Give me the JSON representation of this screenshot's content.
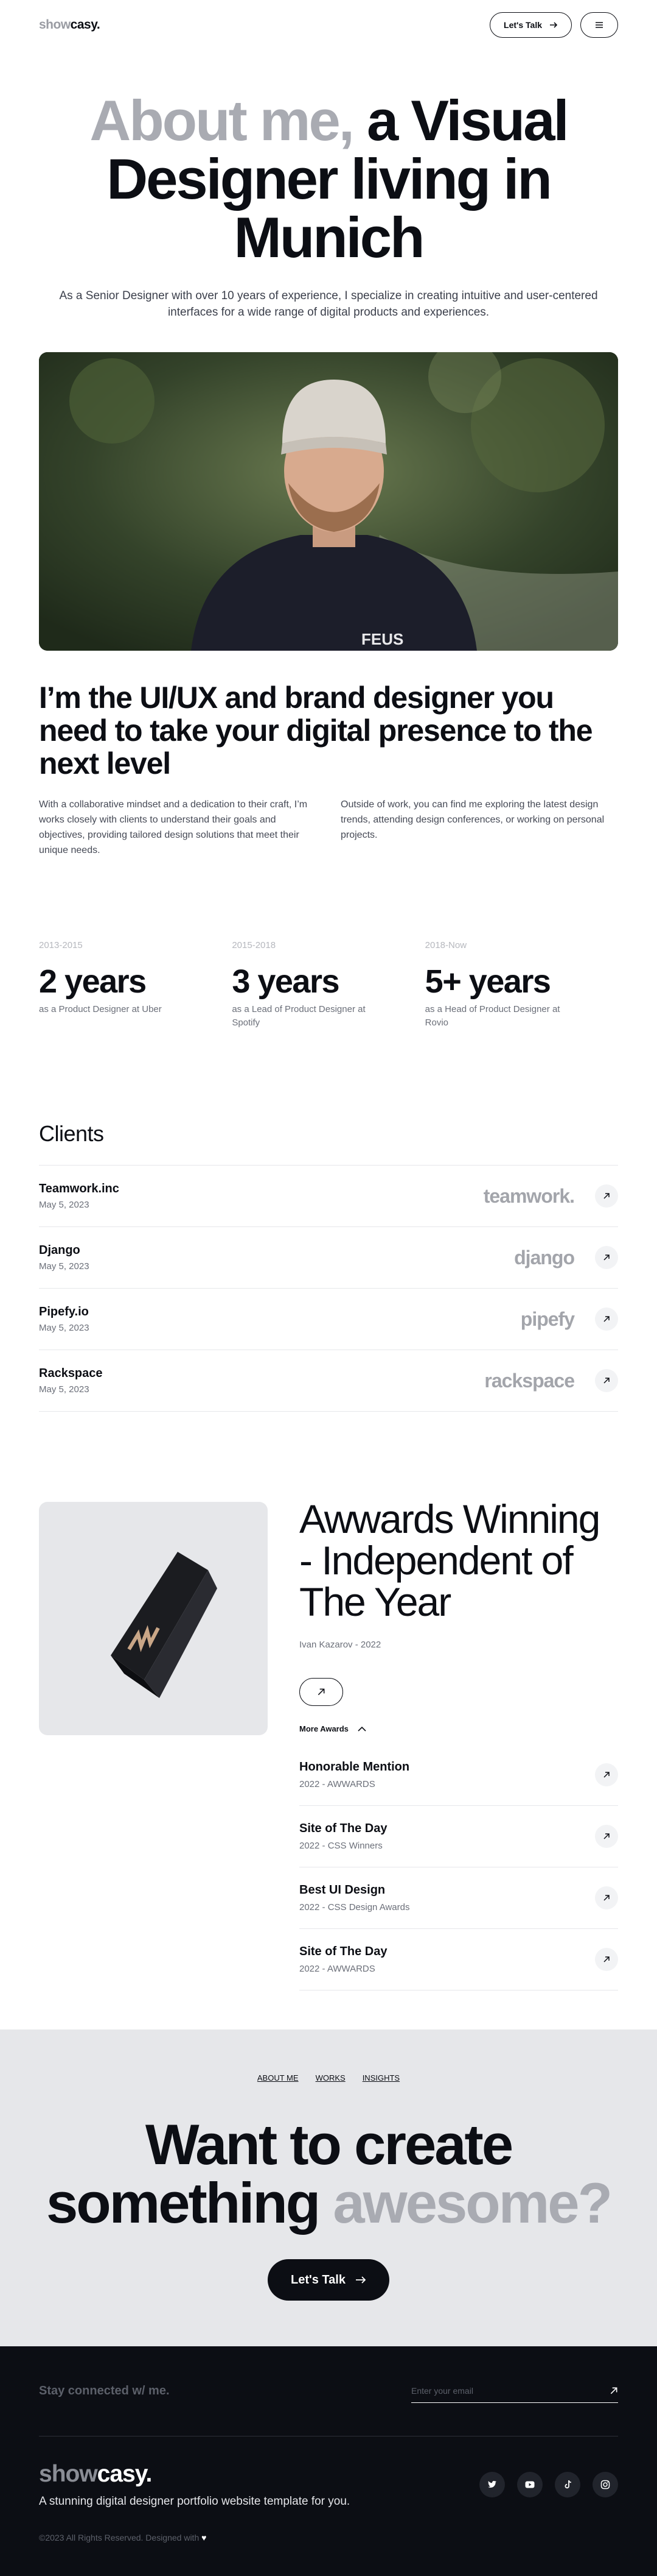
{
  "header": {
    "logo_a": "show",
    "logo_b": "casy.",
    "talk_label": "Let's Talk"
  },
  "hero": {
    "title_grey": "About me,",
    "title_dark": " a Visual Designer living in Munich",
    "subtitle": "As a Senior Designer with over 10 years of experience, I specialize in creating intuitive and user-centered interfaces for a wide range of digital products and experiences.",
    "shirt_text": "FEUS"
  },
  "intro": {
    "heading": "I’m the UI/UX and brand designer you need to take your digital presence to the next level",
    "col1": "With a collaborative mindset and a dedication to their craft, I’m works closely with clients to understand their goals and objectives, providing tailored design solutions that meet their unique needs.",
    "col2": "Outside of work, you can find me exploring the latest design trends, attending design conferences, or working on personal projects."
  },
  "stats": [
    {
      "years": "2013-2015",
      "value": "2 years",
      "desc": "as a Product Designer at Uber"
    },
    {
      "years": "2015-2018",
      "value": "3 years",
      "desc": "as a Lead of Product Designer at Spotify"
    },
    {
      "years": "2018-Now",
      "value": "5+ years",
      "desc": "as a Head of Product Designer at Rovio"
    }
  ],
  "clients": {
    "title": "Clients",
    "items": [
      {
        "name": "Teamwork.inc",
        "date": "May 5, 2023",
        "brand": "teamwork."
      },
      {
        "name": "Django",
        "date": "May 5, 2023",
        "brand": "django"
      },
      {
        "name": "Pipefy.io",
        "date": "May 5, 2023",
        "brand": "pipefy"
      },
      {
        "name": "Rackspace",
        "date": "May 5, 2023",
        "brand": "rackspace"
      }
    ]
  },
  "awards": {
    "title": "Awwards Winning - Independent of The Year",
    "sub": "Ivan Kazarov - 2022",
    "more_label": "More Awards",
    "items": [
      {
        "name": "Honorable Mention",
        "meta": "2022 - AWWARDS"
      },
      {
        "name": "Site of The Day",
        "meta": "2022 - CSS Winners"
      },
      {
        "name": "Best UI Design",
        "meta": "2022 - CSS Design Awards"
      },
      {
        "name": "Site of The Day",
        "meta": "2022 - AWWARDS"
      }
    ]
  },
  "cta": {
    "nav": [
      "ABOUT ME",
      "WORKS",
      "INSIGHTS"
    ],
    "line1": "Want to create",
    "line2_dark": "something ",
    "line2_grey": "awesome?",
    "button": "Let's Talk"
  },
  "footer": {
    "stay": "Stay connected w/ me.",
    "email_placeholder": "Enter your email",
    "logo_a": "show",
    "logo_b": "casy.",
    "tagline": "A stunning digital designer portfolio website template for you.",
    "copyright": "©2023 All Rights Reserved. Designed with"
  },
  "colors": {
    "dark": "#0c0e14",
    "grey_text": "#a9abb2",
    "panel": "#e6e7ea"
  }
}
